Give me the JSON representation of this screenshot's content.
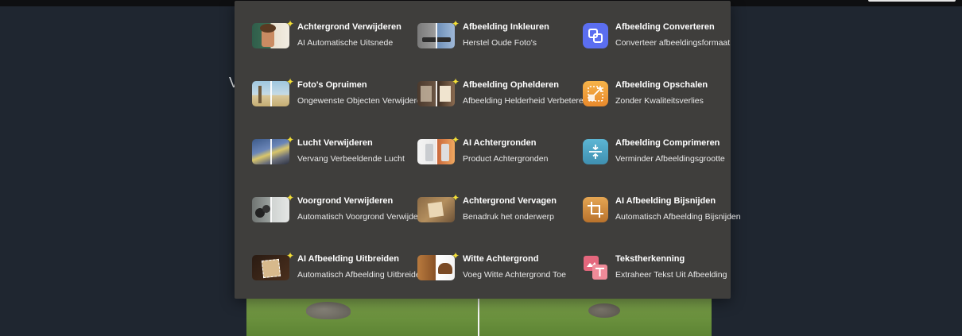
{
  "background": {
    "heading_partial": "V"
  },
  "menu": {
    "columns": [
      [
        {
          "title": "Achtergrond Verwijderen",
          "subtitle": "AI Automatische Uitsnede"
        },
        {
          "title": "Foto's Opruimen",
          "subtitle": "Ongewenste Objecten Verwijderen"
        },
        {
          "title": "Lucht Verwijderen",
          "subtitle": "Vervang Verbeeldende Lucht"
        },
        {
          "title": "Voorgrond Verwijderen",
          "subtitle": "Automatisch Voorgrond Verwijderen"
        },
        {
          "title": "AI Afbeelding Uitbreiden",
          "subtitle": "Automatisch Afbeelding Uitbreiden"
        }
      ],
      [
        {
          "title": "Afbeelding Inkleuren",
          "subtitle": "Herstel Oude Foto's"
        },
        {
          "title": "Afbeelding Ophelderen",
          "subtitle": "Afbeelding Helderheid Verbeteren"
        },
        {
          "title": "AI Achtergronden",
          "subtitle": "Product Achtergronden"
        },
        {
          "title": "Achtergrond Vervagen",
          "subtitle": "Benadruk het onderwerp"
        },
        {
          "title": "Witte Achtergrond",
          "subtitle": "Voeg Witte Achtergrond Toe"
        }
      ],
      [
        {
          "title": "Afbeelding Converteren",
          "subtitle": "Converteer afbeeldingsformaat"
        },
        {
          "title": "Afbeelding Opschalen",
          "subtitle": "Zonder Kwaliteitsverlies"
        },
        {
          "title": "Afbeelding Comprimeren",
          "subtitle": "Verminder Afbeeldingsgrootte"
        },
        {
          "title": "AI Afbeelding Bijsnijden",
          "subtitle": "Automatisch Afbeelding Bijsnijden"
        },
        {
          "title": "Tekstherkenning",
          "subtitle": "Extraheer Tekst Uit Afbeelding"
        }
      ]
    ],
    "ai_badge": "✦",
    "icons": {
      "convert": "convert-icon",
      "upscale": "upscale-icon",
      "compress": "compress-icon",
      "crop": "crop-icon",
      "ocr": "text-recognition-icon"
    },
    "colors": {
      "panel": "#3f3e3c",
      "badge": "#f3df37",
      "convert": "#5b6ef0",
      "upscale": "#f0a23a",
      "compress": "#4fa3c4",
      "crop": "#e3a04a",
      "ocr": "#e4677d"
    }
  }
}
